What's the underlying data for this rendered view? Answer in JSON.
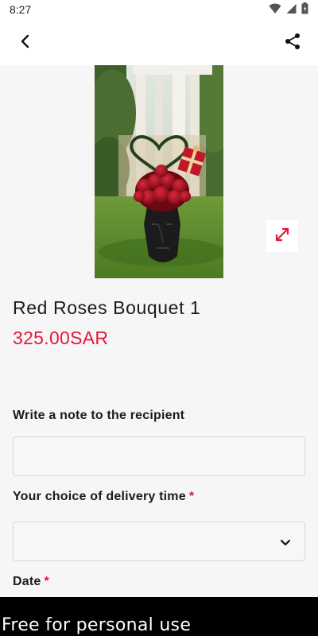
{
  "status_bar": {
    "time": "8:27",
    "icons": [
      "wifi-icon",
      "signal-icon",
      "battery-icon"
    ]
  },
  "app_bar": {
    "back_icon": "back-arrow-icon",
    "share_icon": "share-icon"
  },
  "product": {
    "name": "Red Roses Bouquet 1",
    "price": "325.00SAR",
    "image_description_icon": "expand-icon"
  },
  "form": {
    "note_label": "Write a note to the recipient",
    "note_value": "",
    "delivery_time_label": "Your choice of delivery time",
    "delivery_time_required": "*",
    "delivery_time_value": "",
    "date_label": "Date",
    "date_required": "*"
  },
  "watermark": {
    "text": "Free for personal use"
  },
  "colors": {
    "accent": "#e8173a",
    "text": "#1e1a16",
    "background": "#f6f6f6"
  }
}
